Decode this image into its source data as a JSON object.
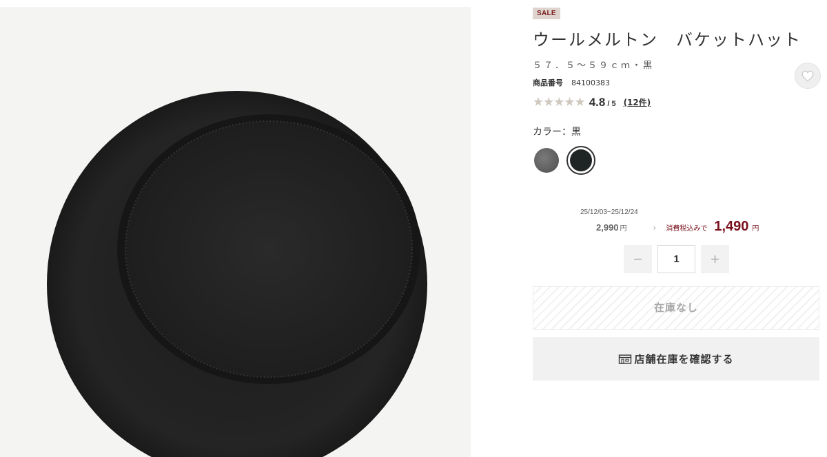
{
  "product": {
    "badge": "SALE",
    "title": "ウールメルトン　バケットハット",
    "variant": "５７．５〜５９ｃｍ・黒",
    "number_label": "商品番号",
    "number": "84100383"
  },
  "rating": {
    "stars": "★★★★★",
    "score": "4.8",
    "out_of": "/ 5",
    "count": "(12件)"
  },
  "color": {
    "label": "カラー：黒",
    "swatches": [
      {
        "name": "gray",
        "hex": "#6a6a6a",
        "selected": false
      },
      {
        "name": "black",
        "hex": "#1f2425",
        "selected": true
      }
    ]
  },
  "price": {
    "period": "25/12/03~25/12/24",
    "original": "2,990",
    "original_unit": "円",
    "arrow": "›",
    "tax_label": "消費税込みで",
    "sale": "1,490",
    "sale_unit": "円"
  },
  "quantity": {
    "minus": "−",
    "value": "1",
    "plus": "+"
  },
  "buttons": {
    "sold_out": "在庫なし",
    "store_stock": "店舗在庫を確認する"
  },
  "icons": {
    "favorite": "heart-icon",
    "store": "store-icon"
  },
  "colors": {
    "sale_red": "#7a0f1c",
    "badge_bg": "#ded3cf"
  }
}
